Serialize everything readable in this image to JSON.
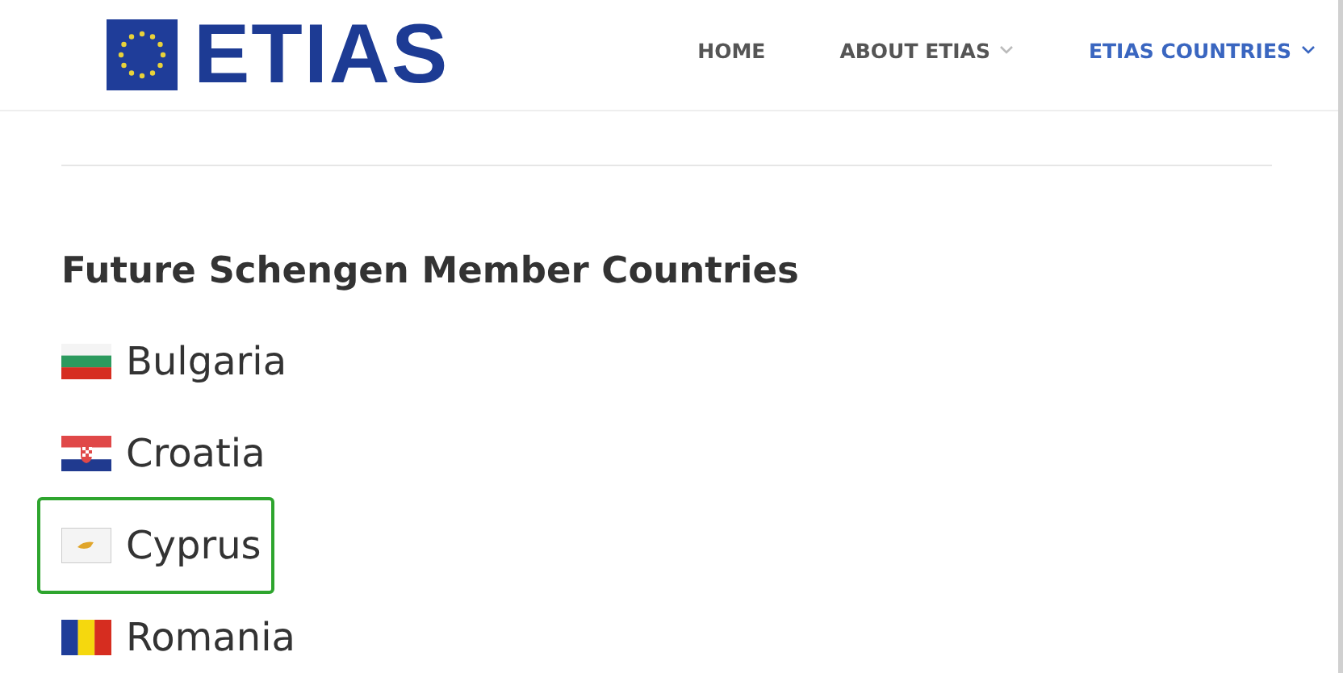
{
  "logo": {
    "text": "ETIAS"
  },
  "nav": [
    {
      "label": "HOME",
      "selected": false,
      "dropdown": false
    },
    {
      "label": "ABOUT ETIAS",
      "selected": false,
      "dropdown": true
    },
    {
      "label": "ETIAS COUNTRIES",
      "selected": true,
      "dropdown": true
    }
  ],
  "heading": "Future Schengen Member Countries",
  "countries": [
    {
      "name": "Bulgaria",
      "kind": "bg",
      "highlighted": false
    },
    {
      "name": "Croatia",
      "kind": "hr",
      "highlighted": false
    },
    {
      "name": "Cyprus",
      "kind": "cy",
      "highlighted": true
    },
    {
      "name": "Romania",
      "kind": "ro",
      "highlighted": false
    }
  ]
}
